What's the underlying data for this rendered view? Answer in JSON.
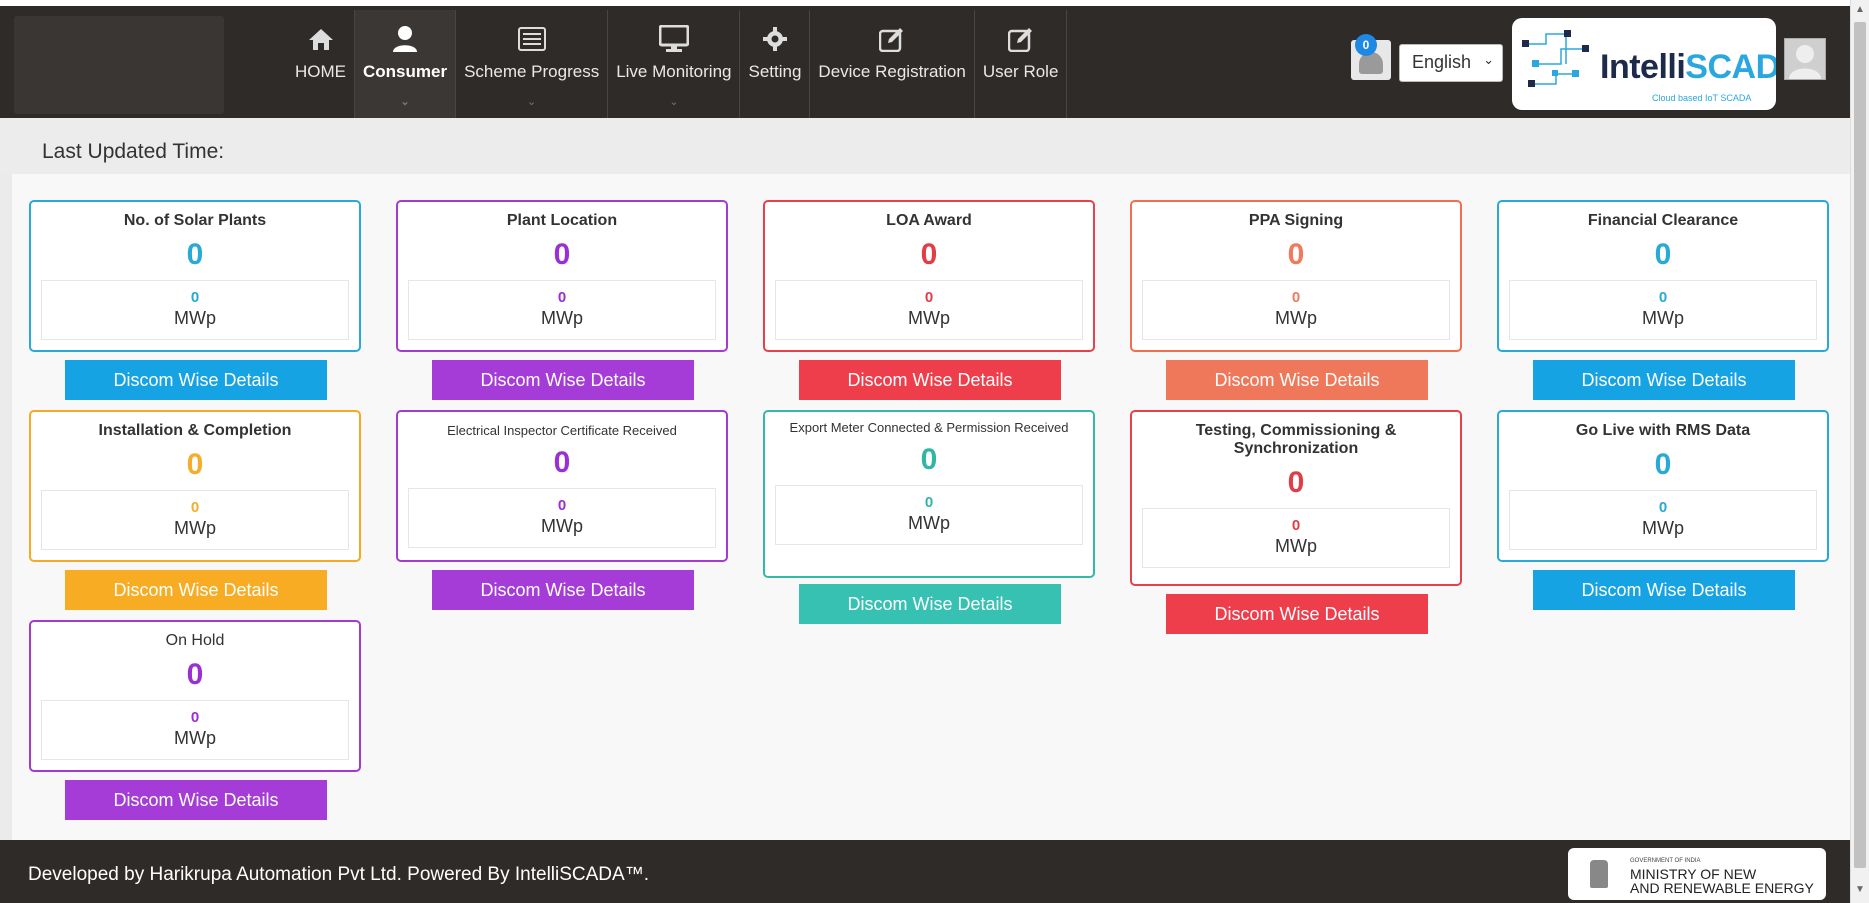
{
  "nav": {
    "items": [
      {
        "label": "HOME",
        "icon": "home-icon"
      },
      {
        "label": "Consumer",
        "icon": "user-icon"
      },
      {
        "label": "Scheme Progress",
        "icon": "list-icon"
      },
      {
        "label": "Live Monitoring",
        "icon": "monitor-icon"
      },
      {
        "label": "Setting",
        "icon": "gear-icon"
      },
      {
        "label": "Device Registration",
        "icon": "edit-icon"
      },
      {
        "label": "User Role",
        "icon": "edit-icon"
      }
    ],
    "active": "Consumer"
  },
  "header": {
    "notification_count": "0",
    "language": "English",
    "logo_main": "Intelli",
    "logo_accent": "SCADA",
    "logo_tagline": "Cloud based IoT SCADA"
  },
  "status": {
    "last_updated_label": "Last Updated Time:"
  },
  "cards": [
    {
      "title": "No. of Solar Plants",
      "count": "0",
      "mwp_value": "0",
      "unit": "MWp",
      "button": "Discom Wise Details",
      "color": "#29a9d6"
    },
    {
      "title": "Plant Location",
      "count": "0",
      "mwp_value": "0",
      "unit": "MWp",
      "button": "Discom Wise Details",
      "color": "#a23bd0"
    },
    {
      "title": "LOA Award",
      "count": "0",
      "mwp_value": "0",
      "unit": "MWp",
      "button": "Discom Wise Details",
      "color": "#e4414b"
    },
    {
      "title": "PPA Signing",
      "count": "0",
      "mwp_value": "0",
      "unit": "MWp",
      "button": "Discom Wise Details",
      "color": "#ef6f4e"
    },
    {
      "title": "Financial Clearance",
      "count": "0",
      "mwp_value": "0",
      "unit": "MWp",
      "button": "Discom Wise Details",
      "color": "#29a9d6"
    },
    {
      "title": "Installation & Completion",
      "count": "0",
      "mwp_value": "0",
      "unit": "MWp",
      "button": "Discom Wise Details",
      "color": "#f4aa24"
    },
    {
      "title": "Electrical Inspector Certificate Received",
      "count": "0",
      "mwp_value": "0",
      "unit": "MWp",
      "button": "Discom Wise Details",
      "color": "#a23bd0"
    },
    {
      "title": "Export Meter Connected & Permission Received",
      "count": "0",
      "mwp_value": "0",
      "unit": "MWp",
      "button": "Discom Wise Details",
      "color": "#33b9aa"
    },
    {
      "title": "Testing, Commissioning & Synchronization",
      "count": "0",
      "mwp_value": "0",
      "unit": "MWp",
      "button": "Discom Wise Details",
      "color": "#e4414b"
    },
    {
      "title": "Go Live with RMS Data",
      "count": "0",
      "mwp_value": "0",
      "unit": "MWp",
      "button": "Discom Wise Details",
      "color": "#29a9d6"
    },
    {
      "title": "On Hold",
      "count": "0",
      "mwp_value": "0",
      "unit": "MWp",
      "button": "Discom Wise Details",
      "color": "#a23bd0"
    }
  ],
  "footer": {
    "text": "Developed by Harikrupa Automation Pvt Ltd. Powered By IntelliSCADA™.",
    "ministry_gov": "GOVERNMENT OF INDIA",
    "ministry_line1": "MINISTRY OF NEW",
    "ministry_line2": "AND RENEWABLE ENERGY"
  }
}
